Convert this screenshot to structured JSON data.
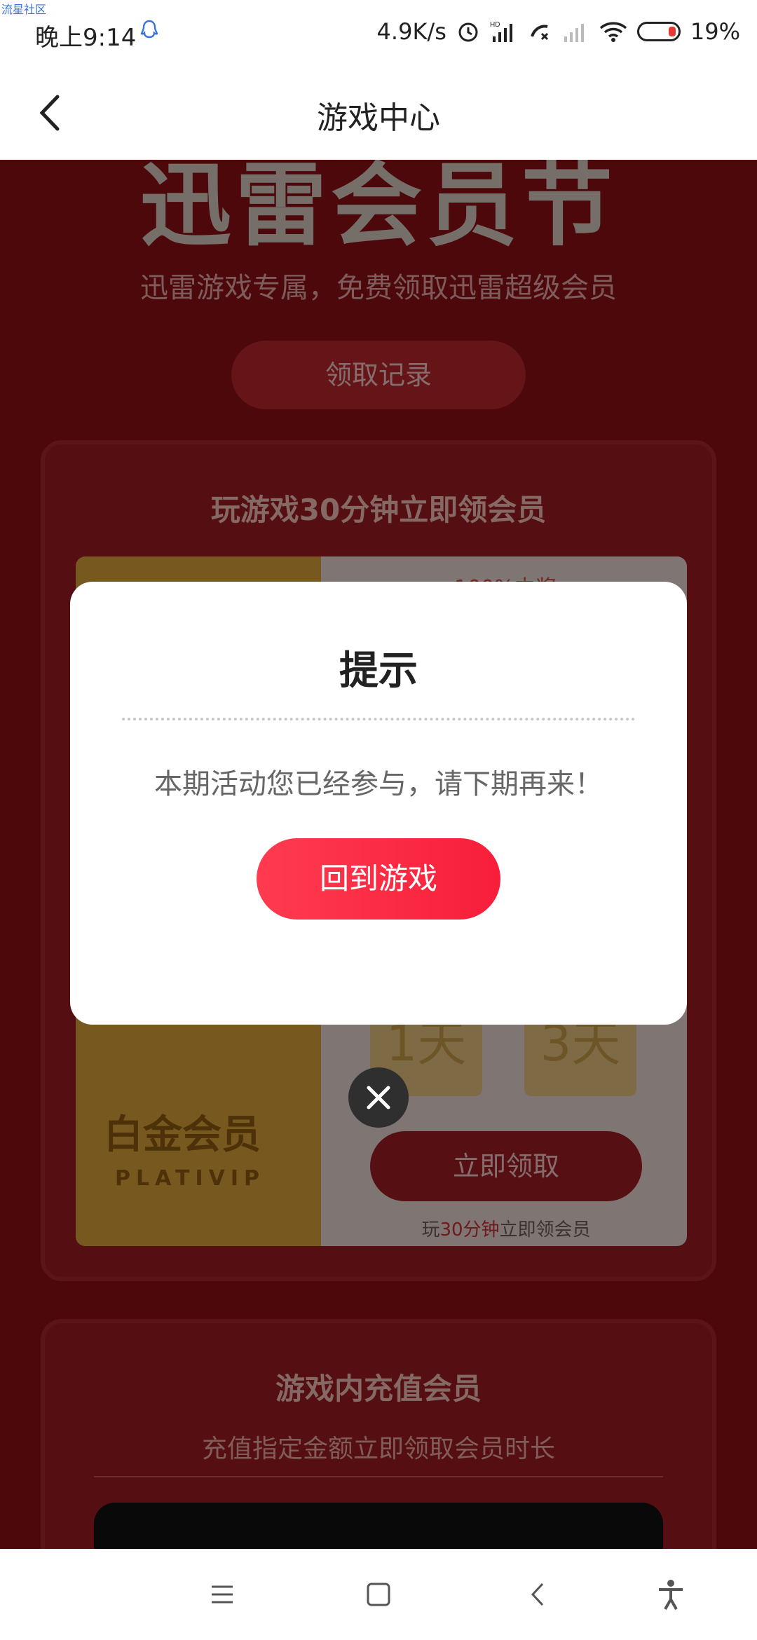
{
  "watermark": "流星社区",
  "status_bar": {
    "time": "晚上9:14",
    "net_speed": "4.9K/s",
    "battery": "19%"
  },
  "header": {
    "title": "游戏中心"
  },
  "banner": {
    "title": "迅雷会员节",
    "subtitle": "迅雷游戏专属，免费领取迅雷超级会员",
    "record_button": "领取记录"
  },
  "card_play": {
    "heading": "玩游戏30分钟立即领会员",
    "chance_text": "100%中奖",
    "tier_label": "白金会员",
    "tier_label_en": "PLATIVIP",
    "options": [
      "1天",
      "3天"
    ],
    "claim_button": "立即领取",
    "note_prefix": "玩",
    "note_highlight": "30分钟",
    "note_suffix": "立即领会员"
  },
  "card_recharge": {
    "heading": "游戏内充值会员",
    "subtitle": "充值指定金额立即领取会员时长"
  },
  "dialog": {
    "title": "提示",
    "message": "本期活动您已经参与，请下期再来！",
    "button_label": "回到游戏"
  },
  "colors": {
    "page_bg": "#8a0f14",
    "dialog_button": "#f71e3a",
    "highlight": "#c8323a"
  }
}
